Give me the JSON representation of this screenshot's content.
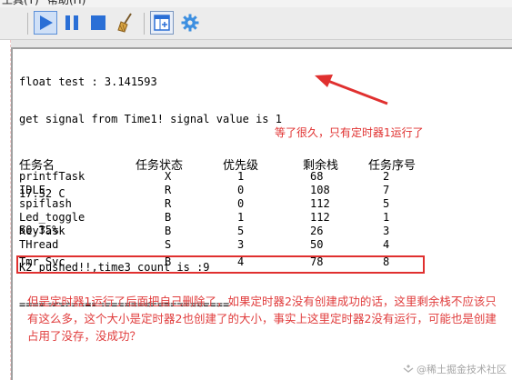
{
  "menu": {
    "items": [
      "工具(T)",
      "帮助(H)"
    ]
  },
  "toolbar": {
    "buttons": [
      {
        "name": "run-icon"
      },
      {
        "name": "pause-icon"
      },
      {
        "name": "stop-icon"
      },
      {
        "name": "clear-icon"
      },
      {
        "name": "window-icon"
      },
      {
        "name": "gear-icon"
      }
    ],
    "accent": "#2a6fd6"
  },
  "terminal": {
    "lines": [
      "float test : 3.141593",
      "get signal from Time1! signal value is 1",
      "",
      "17.32 C",
      "50.35%",
      "K2 pushed!!,time3_count is :9",
      "================================"
    ],
    "table": {
      "headers": [
        "任务名",
        "任务状态",
        "优先级",
        "剩余栈",
        "任务序号"
      ],
      "rows": [
        [
          "printfTask",
          "X",
          "1",
          "68",
          "2"
        ],
        [
          "IDLE",
          "R",
          "0",
          "108",
          "7"
        ],
        [
          "spiflash",
          "R",
          "0",
          "112",
          "5"
        ],
        [
          "Led_toggle",
          "B",
          "1",
          "112",
          "1"
        ],
        [
          "KeyTask",
          "B",
          "5",
          "26",
          "3"
        ],
        [
          "THread",
          "S",
          "3",
          "50",
          "4"
        ],
        [
          "Tmr Svc",
          "B",
          "4",
          "78",
          "8"
        ]
      ]
    }
  },
  "annotations": {
    "top_note": "等了很久，只有定时器1运行了",
    "bottom_note": "但是定时器1运行了后面把自己删除了，如果定时器2没有创建成功的话，这里剩余栈不应该只有这么多，这个大小是定时器2也创建了的大小，事实上这里定时器2没有运行，可能也是创建占用了没存，没成功？",
    "color": "#e0302f"
  },
  "watermark": {
    "text": "@稀土掘金技术社区"
  }
}
